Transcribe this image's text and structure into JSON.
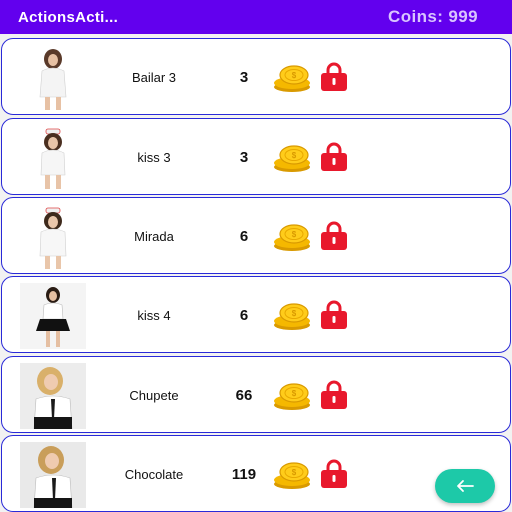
{
  "app": {
    "title": "ActionsActi...",
    "coins_label": "Coins: 999"
  },
  "colors": {
    "appbar": "#6200ee",
    "card_border": "#2a2ad8",
    "coin_gold": "#f5b800",
    "lock_red": "#e8182c",
    "fab": "#1dc9a8"
  },
  "actions": [
    {
      "name": "Bailar 3",
      "price": "3",
      "icon": "gold-coins-icon",
      "lock": "lock-icon"
    },
    {
      "name": "kiss 3",
      "price": "3",
      "icon": "gold-coins-icon",
      "lock": "lock-icon"
    },
    {
      "name": "Mirada",
      "price": "6",
      "icon": "gold-coins-icon",
      "lock": "lock-icon"
    },
    {
      "name": "kiss 4",
      "price": "6",
      "icon": "gold-coins-icon",
      "lock": "lock-icon"
    },
    {
      "name": "Chupete",
      "price": "66",
      "icon": "gold-coins-icon",
      "lock": "lock-icon"
    },
    {
      "name": "Chocolate",
      "price": "119",
      "icon": "gold-coins-icon",
      "lock": "lock-icon"
    }
  ],
  "fab": {
    "icon": "arrow-left-icon"
  }
}
